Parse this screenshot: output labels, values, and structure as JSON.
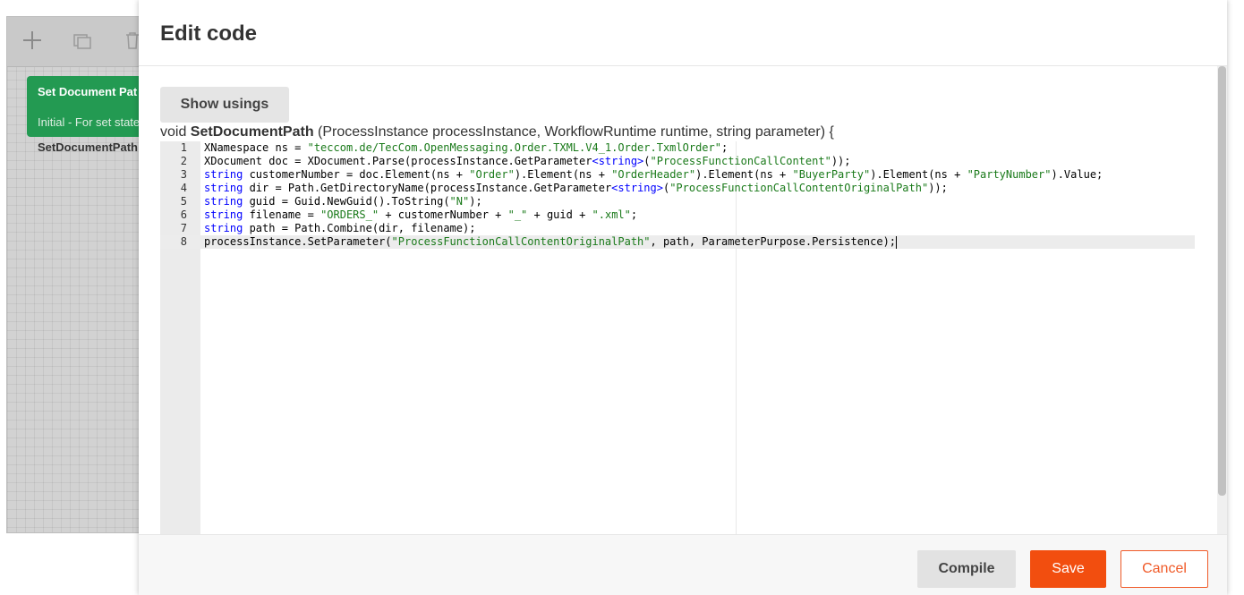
{
  "background": {
    "toolbar_icons": [
      "plus-icon",
      "copy-icon",
      "trash-icon"
    ],
    "activity": {
      "title": "Set Document Pat",
      "subtitle": "Initial - For set state",
      "caption": "SetDocumentPath"
    }
  },
  "modal": {
    "title": "Edit code",
    "show_usings_label": "Show usings",
    "signature": {
      "prefix": "void ",
      "name": "SetDocumentPath",
      "params": " (ProcessInstance processInstance, WorkflowRuntime runtime, string parameter) {"
    },
    "code_lines": [
      {
        "number": "1",
        "tokens": [
          [
            "p",
            "XNamespace ns = "
          ],
          [
            "s",
            "\"teccom.de/TecCom.OpenMessaging.Order.TXML.V4_1.Order.TxmlOrder\""
          ],
          [
            "p",
            ";"
          ]
        ]
      },
      {
        "number": "2",
        "tokens": [
          [
            "p",
            "XDocument doc = XDocument.Parse(processInstance.GetParameter"
          ],
          [
            "k",
            "<string>"
          ],
          [
            "p",
            "("
          ],
          [
            "s",
            "\"ProcessFunctionCallContent\""
          ],
          [
            "p",
            "));"
          ]
        ]
      },
      {
        "number": "3",
        "tokens": [
          [
            "k",
            "string"
          ],
          [
            "p",
            " customerNumber = doc.Element(ns + "
          ],
          [
            "s",
            "\"Order\""
          ],
          [
            "p",
            ").Element(ns + "
          ],
          [
            "s",
            "\"OrderHeader\""
          ],
          [
            "p",
            ").Element(ns + "
          ],
          [
            "s",
            "\"BuyerParty\""
          ],
          [
            "p",
            ").Element(ns + "
          ],
          [
            "s",
            "\"PartyNumber\""
          ],
          [
            "p",
            ").Value;"
          ]
        ]
      },
      {
        "number": "4",
        "tokens": [
          [
            "k",
            "string"
          ],
          [
            "p",
            " dir = Path.GetDirectoryName(processInstance.GetParameter"
          ],
          [
            "k",
            "<string>"
          ],
          [
            "p",
            "("
          ],
          [
            "s",
            "\"ProcessFunctionCallContentOriginalPath\""
          ],
          [
            "p",
            "));"
          ]
        ]
      },
      {
        "number": "5",
        "tokens": [
          [
            "k",
            "string"
          ],
          [
            "p",
            " guid = Guid.NewGuid().ToString("
          ],
          [
            "s",
            "\"N\""
          ],
          [
            "p",
            ");"
          ]
        ]
      },
      {
        "number": "6",
        "tokens": [
          [
            "k",
            "string"
          ],
          [
            "p",
            " filename = "
          ],
          [
            "s",
            "\"ORDERS_\""
          ],
          [
            "p",
            " + customerNumber + "
          ],
          [
            "s",
            "\"_\""
          ],
          [
            "p",
            " + guid + "
          ],
          [
            "s",
            "\".xml\""
          ],
          [
            "p",
            ";"
          ]
        ]
      },
      {
        "number": "7",
        "tokens": [
          [
            "k",
            "string"
          ],
          [
            "p",
            " path = Path.Combine(dir, filename);"
          ]
        ]
      },
      {
        "number": "8",
        "tokens": [
          [
            "p",
            "processInstance.SetParameter("
          ],
          [
            "s",
            "\"ProcessFunctionCallContentOriginalPath\""
          ],
          [
            "p",
            ", path, ParameterPurpose.Persistence);"
          ]
        ]
      }
    ],
    "active_line": "8",
    "footer": {
      "compile_label": "Compile",
      "save_label": "Save",
      "cancel_label": "Cancel"
    },
    "colors": {
      "save": "#f24e0f",
      "cancel_border": "#f05a28",
      "activity": "#239a52",
      "keyword": "#0000ff",
      "string": "#1a7a1a"
    }
  }
}
